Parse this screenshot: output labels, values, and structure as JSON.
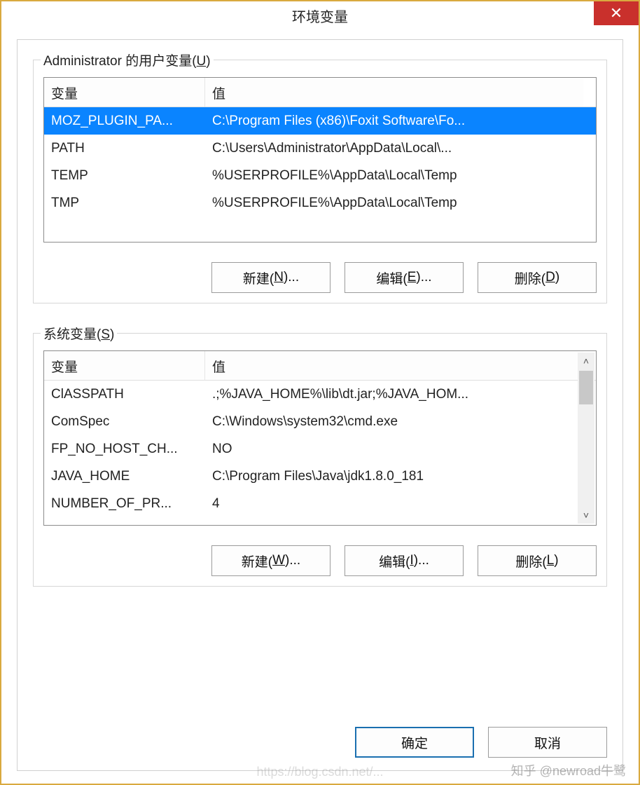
{
  "window": {
    "title": "环境变量",
    "close_icon": "✕"
  },
  "user_section": {
    "label_prefix": "Administrator 的用户变量(",
    "label_hotkey": "U",
    "label_suffix": ")",
    "col_variable": "变量",
    "col_value": "值",
    "rows": [
      {
        "var": "MOZ_PLUGIN_PA...",
        "val": "C:\\Program Files (x86)\\Foxit Software\\Fo...",
        "selected": true
      },
      {
        "var": "PATH",
        "val": "C:\\Users\\Administrator\\AppData\\Local\\...",
        "selected": false
      },
      {
        "var": "TEMP",
        "val": "%USERPROFILE%\\AppData\\Local\\Temp",
        "selected": false
      },
      {
        "var": "TMP",
        "val": "%USERPROFILE%\\AppData\\Local\\Temp",
        "selected": false
      }
    ],
    "btn_new_pre": "新建(",
    "btn_new_hot": "N",
    "btn_new_suf": ")...",
    "btn_edit_pre": "编辑(",
    "btn_edit_hot": "E",
    "btn_edit_suf": ")...",
    "btn_del_pre": "删除(",
    "btn_del_hot": "D",
    "btn_del_suf": ")"
  },
  "system_section": {
    "label_prefix": "系统变量(",
    "label_hotkey": "S",
    "label_suffix": ")",
    "col_variable": "变量",
    "col_value": "值",
    "rows": [
      {
        "var": "ClASSPATH",
        "val": ".;%JAVA_HOME%\\lib\\dt.jar;%JAVA_HOM..."
      },
      {
        "var": "ComSpec",
        "val": "C:\\Windows\\system32\\cmd.exe"
      },
      {
        "var": "FP_NO_HOST_CH...",
        "val": "NO"
      },
      {
        "var": "JAVA_HOME",
        "val": "C:\\Program Files\\Java\\jdk1.8.0_181"
      },
      {
        "var": "NUMBER_OF_PR...",
        "val": "4"
      }
    ],
    "btn_new_pre": "新建(",
    "btn_new_hot": "W",
    "btn_new_suf": ")...",
    "btn_edit_pre": "编辑(",
    "btn_edit_hot": "I",
    "btn_edit_suf": ")...",
    "btn_del_pre": "删除(",
    "btn_del_hot": "L",
    "btn_del_suf": ")"
  },
  "dialog": {
    "ok": "确定",
    "cancel": "取消"
  },
  "watermark": "知乎 @newroad牛鹭",
  "watermark2": "https://blog.csdn.net/..."
}
